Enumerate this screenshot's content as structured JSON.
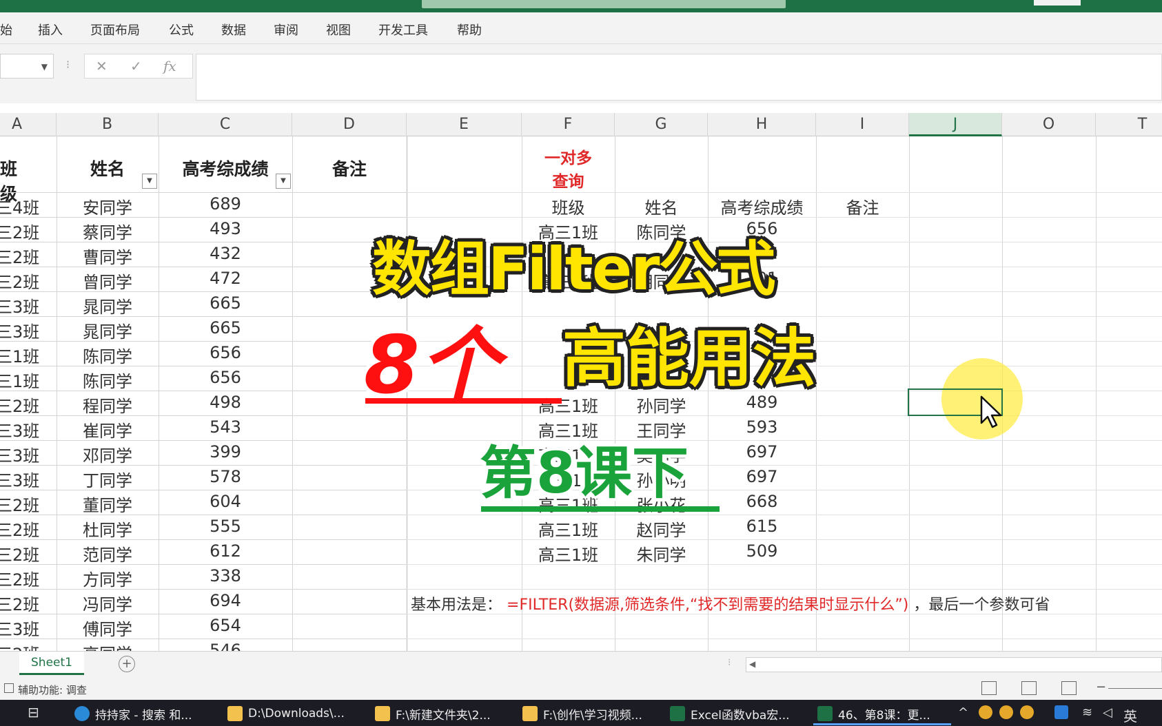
{
  "ribbon": {
    "tabs": [
      "始",
      "插入",
      "页面布局",
      "公式",
      "数据",
      "审阅",
      "视图",
      "开发工具",
      "帮助"
    ]
  },
  "formula_bar": {
    "cancel_icon": "✕",
    "enter_icon": "✓",
    "fx_label": "fx",
    "value": ""
  },
  "columns": [
    "A",
    "B",
    "C",
    "D",
    "E",
    "F",
    "G",
    "H",
    "I",
    "J",
    "O",
    "T"
  ],
  "selected_column": "J",
  "left_table": {
    "headers": [
      "班级",
      "姓名",
      "高考综成绩",
      "备注"
    ],
    "rows": [
      [
        "三4班",
        "安同学",
        "689"
      ],
      [
        "三2班",
        "蔡同学",
        "493"
      ],
      [
        "三2班",
        "曹同学",
        "432"
      ],
      [
        "三2班",
        "曾同学",
        "472"
      ],
      [
        "三3班",
        "晁同学",
        "665"
      ],
      [
        "三3班",
        "晁同学",
        "665"
      ],
      [
        "三1班",
        "陈同学",
        "656"
      ],
      [
        "三1班",
        "陈同学",
        "656"
      ],
      [
        "三2班",
        "程同学",
        "498"
      ],
      [
        "三3班",
        "崔同学",
        "543"
      ],
      [
        "三3班",
        "邓同学",
        "399"
      ],
      [
        "三3班",
        "丁同学",
        "578"
      ],
      [
        "三2班",
        "董同学",
        "604"
      ],
      [
        "三2班",
        "杜同学",
        "555"
      ],
      [
        "三2班",
        "范同学",
        "612"
      ],
      [
        "三2班",
        "方同学",
        "338"
      ],
      [
        "三2班",
        "冯同学",
        "694"
      ],
      [
        "三3班",
        "傅同学",
        "654"
      ],
      [
        "三2班",
        "高同学",
        "546"
      ]
    ]
  },
  "right_table": {
    "title_line1": "一对多",
    "title_line2": "查询",
    "headers": [
      "班级",
      "姓名",
      "高考综成绩",
      "备注"
    ],
    "rows": [
      [
        "高三1班",
        "陈同学",
        "656"
      ],
      [
        "高三1班",
        "胡同学",
        "701"
      ],
      [
        "高三1班",
        "孙同学",
        "489"
      ],
      [
        "高三1班",
        "王同学",
        "593"
      ],
      [
        "高三1班",
        "吴同学",
        "697"
      ],
      [
        "高三1班",
        "孙小明",
        "697"
      ],
      [
        "高三1班",
        "张小花",
        "668"
      ],
      [
        "高三1班",
        "赵同学",
        "615"
      ],
      [
        "高三1班",
        "朱同学",
        "509"
      ]
    ]
  },
  "note": {
    "prefix": "基本用法是：",
    "formula": "=FILTER(数据源,筛选条件,“找不到需要的结果时显示什么”)",
    "suffix": "，最后一个参数可省"
  },
  "overlay": {
    "line1": "数组Filter公式",
    "line2_red": "8个",
    "line2_yellow": "高能用法",
    "line3": "第8课下"
  },
  "sheets": [
    "Sheet1"
  ],
  "status": {
    "accessibility": "辅助功能: 调查"
  },
  "taskbar": {
    "items": [
      "持持家 - 搜索 和...",
      "D:\\Downloads\\...",
      "F:\\新建文件夹\\2...",
      "F:\\创作\\学习视频...",
      "Excel函数vba宏...",
      "46、第8课：更..."
    ],
    "ime": "英"
  },
  "colors": {
    "excel_green": "#217346",
    "title_red": "#e02828",
    "overlay_yellow": "#ffe500",
    "overlay_red": "#ff1010",
    "overlay_green": "#1aa33a"
  }
}
